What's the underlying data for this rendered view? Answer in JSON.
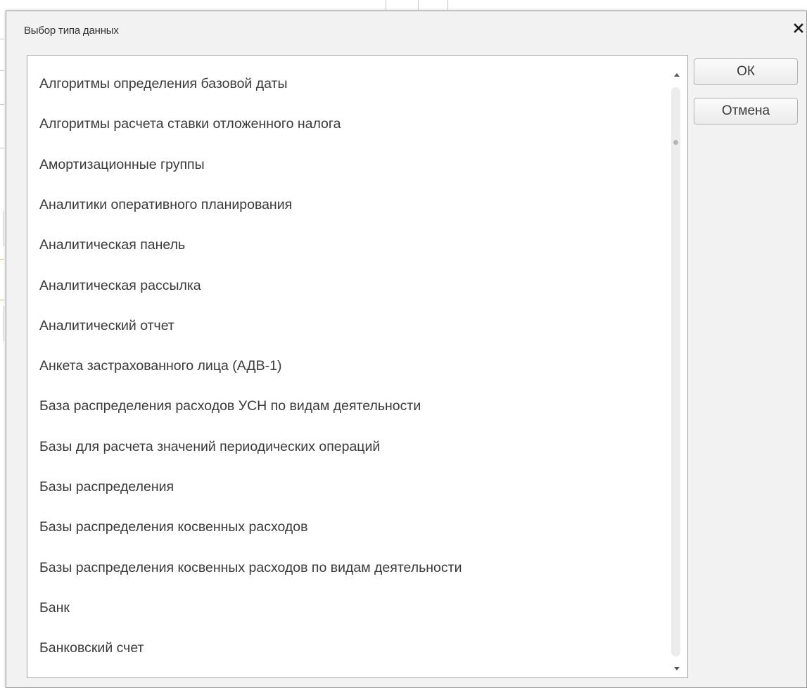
{
  "dialog": {
    "title": "Выбор типа данных",
    "close_icon": "close-icon"
  },
  "list": {
    "items": [
      "Алгоритмы определения базовой даты",
      "Алгоритмы расчета ставки отложенного налога",
      "Амортизационные группы",
      "Аналитики оперативного планирования",
      "Аналитическая панель",
      "Аналитическая рассылка",
      "Аналитический отчет",
      "Анкета застрахованного лица (АДВ-1)",
      "База распределения расходов УСН по видам деятельности",
      "Базы для расчета значений периодических операций",
      "Базы распределения",
      "Базы распределения косвенных расходов",
      "Базы распределения косвенных расходов по видам деятельности",
      "Банк",
      "Банковский счет"
    ]
  },
  "buttons": {
    "ok_label": "ОК",
    "cancel_label": "Отмена"
  },
  "scrollbar": {
    "up_icon": "scroll-up-arrow-icon",
    "down_icon": "scroll-down-arrow-icon"
  }
}
